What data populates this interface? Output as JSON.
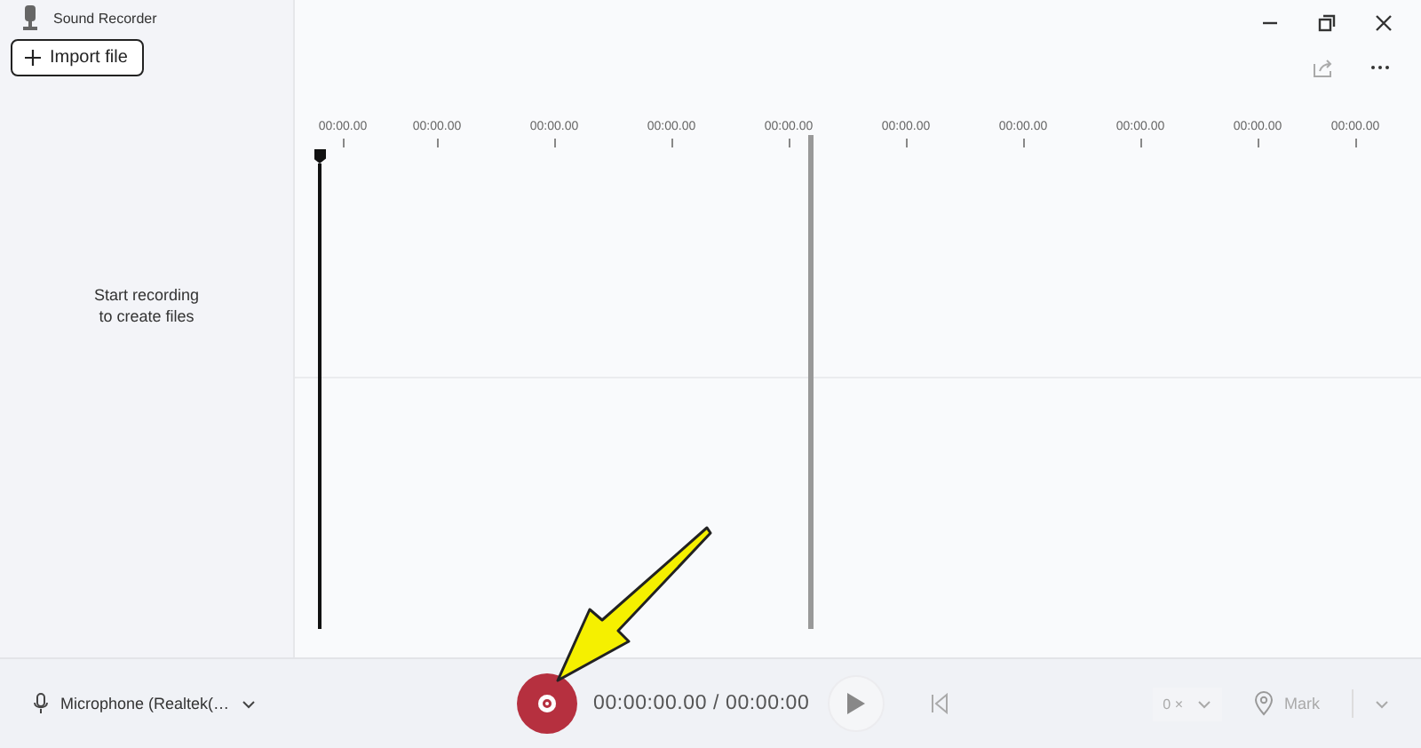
{
  "window": {
    "title": "Sound Recorder"
  },
  "sidebar": {
    "import_button": "Import file",
    "empty_message": "Start recording\nto create files"
  },
  "timeline": {
    "ticks": [
      "00:00.00",
      "00:00.00",
      "00:00.00",
      "00:00.00",
      "00:00.00",
      "00:00.00",
      "00:00.00",
      "00:00.00",
      "00:00.00",
      "00:00.00"
    ]
  },
  "footer": {
    "microphone": "Microphone (Realtek(…",
    "time": "00:00:00.00 / 00:00:00",
    "speed": "0 ×",
    "mark": "Mark"
  }
}
